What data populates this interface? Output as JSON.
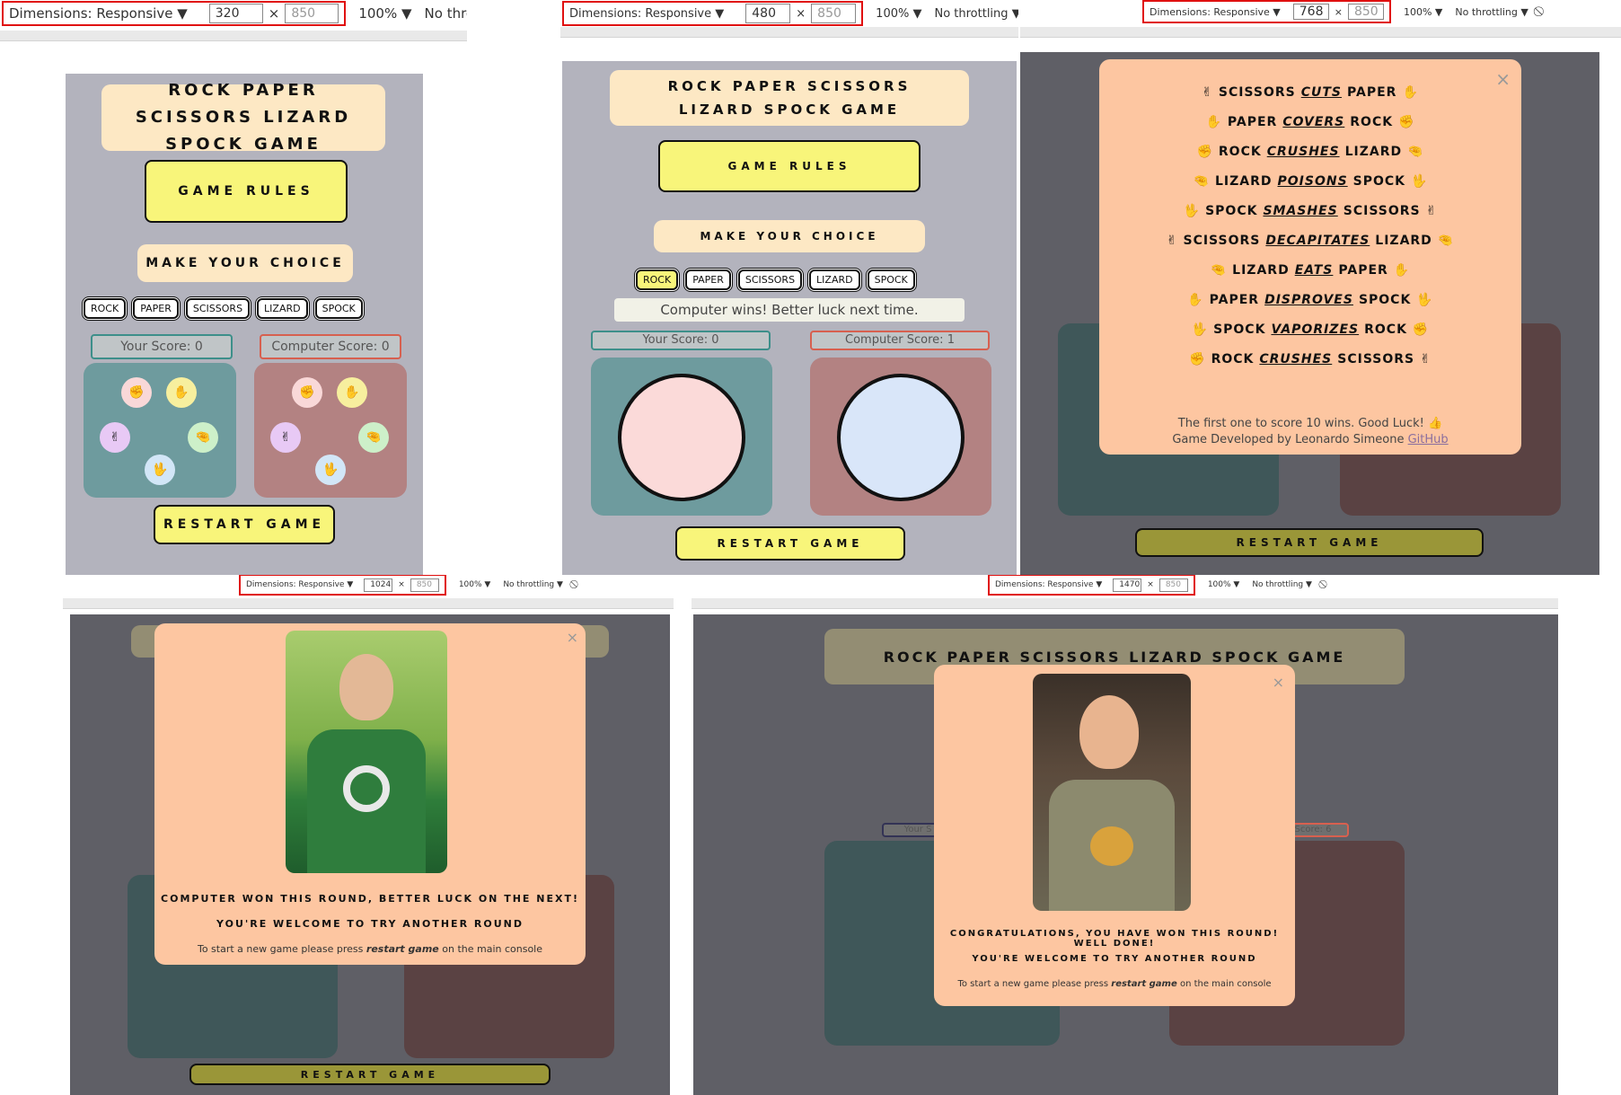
{
  "devtools": [
    {
      "dimensions": "Dimensions: Responsive ▼",
      "width": "320",
      "height": "850",
      "zoom": "100% ▼",
      "throttle": "No throttling ▼"
    },
    {
      "dimensions": "Dimensions: Responsive ▼",
      "width": "480",
      "height": "850",
      "zoom": "100% ▼",
      "throttle": "No throttling ▼"
    },
    {
      "dimensions": "Dimensions: Responsive ▼",
      "width": "768",
      "height": "850",
      "zoom": "100% ▼",
      "throttle": "No throttling ▼"
    },
    {
      "dimensions": "Dimensions: Responsive ▼",
      "width": "1024",
      "height": "850",
      "zoom": "100% ▼",
      "throttle": "No throttling ▼"
    },
    {
      "dimensions": "Dimensions: Responsive ▼",
      "width": "1470",
      "height": "850",
      "zoom": "100% ▼",
      "throttle": "No throttling ▼"
    }
  ],
  "game": {
    "title": "ROCK PAPER SCISSORS LIZARD SPOCK GAME",
    "rules_button": "GAME RULES",
    "choice_heading": "MAKE YOUR CHOICE",
    "choices": [
      "ROCK",
      "PAPER",
      "SCISSORS",
      "LIZARD",
      "SPOCK"
    ],
    "your_score_320": "Your Score: 0",
    "computer_score_320": "Computer Score: 0",
    "your_score_480": "Your Score: 0",
    "computer_score_480": "Computer Score: 1",
    "result_message": "Computer wins! Better luck next time.",
    "restart_button": "RESTART GAME",
    "computer_score_1470": "Score: 6",
    "your_score_1470": "Your S"
  },
  "rules": [
    {
      "a": "SCISSORS",
      "verb": "CUTS",
      "b": "PAPER"
    },
    {
      "a": "PAPER",
      "verb": "COVERS",
      "b": "ROCK"
    },
    {
      "a": "ROCK",
      "verb": "CRUSHES",
      "b": "LIZARD"
    },
    {
      "a": "LIZARD",
      "verb": "POISONS",
      "b": "SPOCK"
    },
    {
      "a": "SPOCK",
      "verb": "SMASHES",
      "b": "SCISSORS"
    },
    {
      "a": "SCISSORS",
      "verb": "DECAPITATES",
      "b": "LIZARD"
    },
    {
      "a": "LIZARD",
      "verb": "EATS",
      "b": "PAPER"
    },
    {
      "a": "PAPER",
      "verb": "DISPROVES",
      "b": "SPOCK"
    },
    {
      "a": "SPOCK",
      "verb": "VAPORIZES",
      "b": "ROCK"
    },
    {
      "a": "ROCK",
      "verb": "CRUSHES",
      "b": "SCISSORS"
    }
  ],
  "rules_footer": {
    "win_text": "The first one to score 10 wins. Good Luck! 👍",
    "credit_prefix": "Game Developed by Leonardo Simeone ",
    "credit_link": "GitHub"
  },
  "lose_modal": {
    "headline": "COMPUTER WON THIS ROUND, BETTER LUCK ON THE NEXT!",
    "sub": "YOU'RE WELCOME TO TRY ANOTHER ROUND",
    "hint_prefix": "To start a new game please press ",
    "hint_em": "restart game",
    "hint_suffix": " on the main console"
  },
  "win_modal": {
    "headline": "CONGRATULATIONS, YOU HAVE WON THIS ROUND! WELL DONE!",
    "sub": "YOU'RE WELCOME TO TRY ANOTHER ROUND",
    "hint_prefix": "To start a new game please press ",
    "hint_em": "restart game",
    "hint_suffix": " on the main console"
  },
  "colors": {
    "yellow": "#f8f57a",
    "cream": "#fde8c4",
    "peach": "#fdc6a1",
    "teal": "#6e9b9e",
    "rose": "#b38282",
    "red_outline": "#e01010"
  },
  "icons": {
    "close": "×",
    "rock": "✊",
    "paper": "✋",
    "scissors": "✌",
    "lizard": "🤏",
    "spock": "🖖"
  }
}
